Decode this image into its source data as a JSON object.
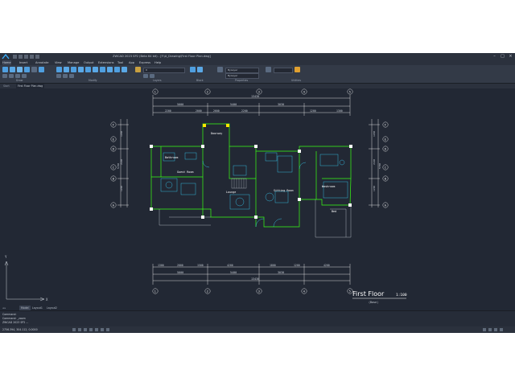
{
  "titlebar": {
    "title": "ZWCAD 2023 SP2 (Beta 64 bit) - [F:\\A_Drawing\\First Floor Plan.dwg]"
  },
  "menubar": {
    "items": [
      "Home",
      "Insert",
      "Annotate",
      "View",
      "Manage",
      "Output",
      "Extensions",
      "Tool",
      "App",
      "Express",
      "Help"
    ],
    "active": "Home"
  },
  "ribbon": {
    "groups": [
      "Draw",
      "Modify",
      "Layers",
      "Block",
      "Properties",
      "Utilities"
    ],
    "layer_value": "0",
    "color_value": "ByLayer",
    "linetype_value": "ByLayer"
  },
  "doctabs": {
    "tabs": [
      "Start",
      "First Floor Plan.dwg"
    ]
  },
  "drawing": {
    "rooms": [
      "Bathroom",
      "Guest Room",
      "Lounge",
      "Sitting Room",
      "Washroom",
      "Bed",
      "Doorway"
    ],
    "col_labels": [
      "1",
      "2",
      "3",
      "4",
      "5"
    ],
    "row_labels": [
      "F",
      "E",
      "D",
      "C",
      "B",
      "A"
    ],
    "top_total": "13430",
    "top_dims": [
      "2200",
      "2000",
      "2600",
      "2200",
      "1200",
      "1300"
    ],
    "top_dims_b": [
      "5000",
      "5400",
      "3030"
    ],
    "bottom_dims": [
      "1300",
      "2800",
      "1500",
      "4200",
      "1800",
      "1200",
      "4200"
    ],
    "bottom_dims_b": [
      "5000",
      "5400",
      "3030"
    ],
    "bottom_total": "13430",
    "left_dims": [
      "1200",
      "2100",
      "1200",
      "1500"
    ],
    "left_total": "5700",
    "right_dims": [
      "1200",
      "2100",
      "1200",
      "1500"
    ],
    "right_total": "5700",
    "plan_title": "First Floor",
    "plan_scale": "1:100",
    "plan_sub": "(Base)",
    "ucs_y": "Y",
    "ucs_x": "X"
  },
  "layouttabs": {
    "tabs": [
      "Model",
      "Layout1",
      "Layout2"
    ]
  },
  "cmdline": {
    "lines": [
      "Command:",
      "Command: _zoom",
      "ZWCAD 2023 SP2 ..."
    ]
  },
  "statusbar": {
    "coords": "2756.394, 304.112, 0.0000"
  },
  "colors": {
    "background": "#222834",
    "lines": "#ffffff",
    "walls": "#39ff14",
    "furniture": "#3ad6ff",
    "highlight": "#ffe600"
  }
}
